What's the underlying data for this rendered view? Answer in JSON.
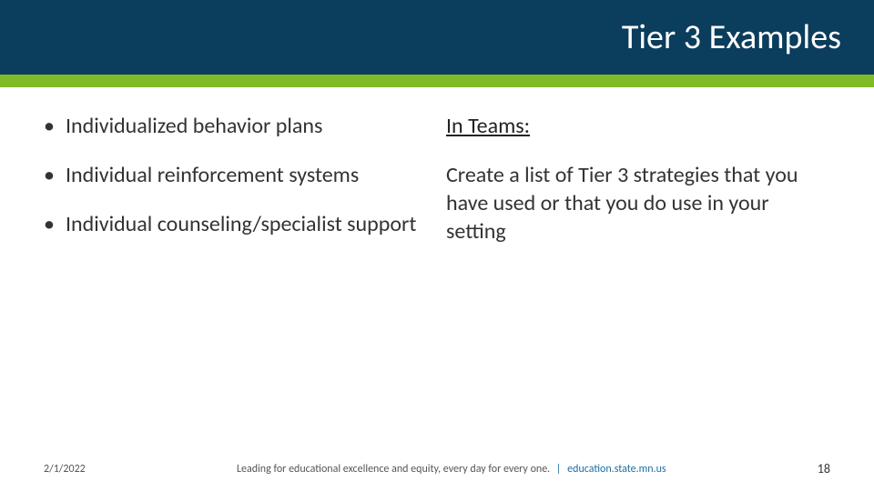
{
  "header": {
    "title": "Tier 3 Examples"
  },
  "left": {
    "bullets": [
      "Individualized behavior plans",
      "Individual reinforcement systems",
      "Individual counseling/specialist support"
    ]
  },
  "right": {
    "heading": "In Teams:",
    "body": "Create a list of Tier 3 strategies that you have used or that you do use in your setting"
  },
  "footer": {
    "date": "2/1/2022",
    "tagline": "Leading for educational excellence and equity, every day for every one.",
    "separator": "|",
    "link": "education.state.mn.us",
    "page": "18"
  }
}
